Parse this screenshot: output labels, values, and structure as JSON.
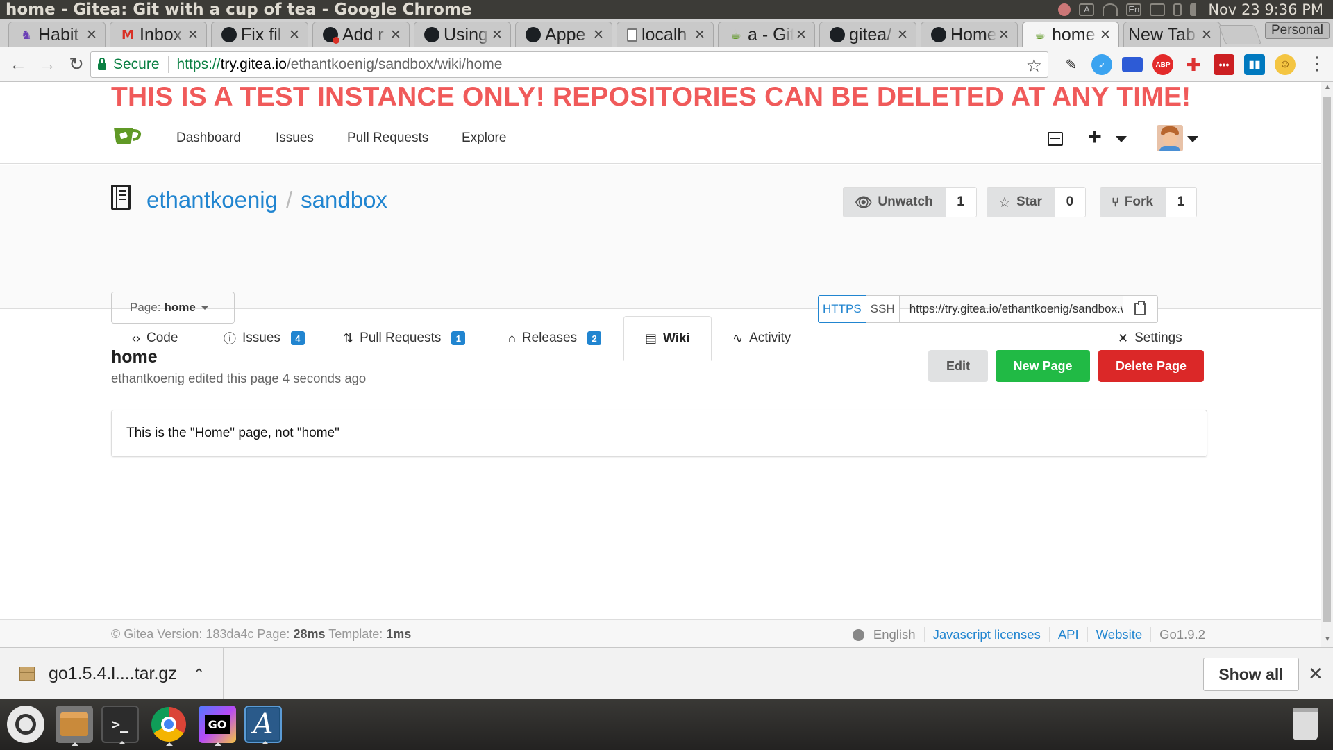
{
  "os": {
    "window_title": "home - Gitea: Git with a cup of tea - Google Chrome",
    "clock": "Nov 23  9:36 PM",
    "tray": [
      "paw-icon",
      "a-icon",
      "wifi-icon",
      "En",
      "mail-icon",
      "battery-icon",
      "volume-icon"
    ]
  },
  "browser": {
    "tabs": [
      {
        "title": "Habit",
        "icon": "habitica-icon"
      },
      {
        "title": "Inbox",
        "icon": "gmail-icon"
      },
      {
        "title": "Fix fil",
        "icon": "github-icon"
      },
      {
        "title": "Add r",
        "icon": "github-icon"
      },
      {
        "title": "Using",
        "icon": "github-icon"
      },
      {
        "title": "Appe",
        "icon": "github-icon"
      },
      {
        "title": "localh",
        "icon": "page-icon"
      },
      {
        "title": "a - Git",
        "icon": "gitea-icon"
      },
      {
        "title": "gitea/",
        "icon": "github-icon"
      },
      {
        "title": "Home",
        "icon": "github-icon"
      },
      {
        "title": "home",
        "icon": "gitea-icon",
        "active": true
      },
      {
        "title": "New Tab",
        "icon": ""
      }
    ],
    "profile": "Personal",
    "secure_label": "Secure",
    "url": {
      "scheme": "https://",
      "host": "try.gitea.io",
      "path": "/ethantkoenig/sandbox/wiki/home"
    },
    "extensions": [
      "pen-icon",
      "compass-icon",
      "calendar-icon",
      "adblock-icon",
      "plus-cross-icon",
      "lastpass-icon",
      "trello-icon",
      "emoji-icon"
    ]
  },
  "page": {
    "banner": "THIS IS A TEST INSTANCE ONLY! REPOSITORIES CAN BE DELETED AT ANY TIME!",
    "nav": {
      "dashboard": "Dashboard",
      "issues": "Issues",
      "pull_requests": "Pull Requests",
      "explore": "Explore"
    },
    "repo": {
      "owner": "ethantkoenig",
      "separator": "/",
      "name": "sandbox",
      "watch_label": "Unwatch",
      "watch_count": "1",
      "star_label": "Star",
      "star_count": "0",
      "fork_label": "Fork",
      "fork_count": "1"
    },
    "tabs": {
      "code": "Code",
      "issues": "Issues",
      "issues_count": "4",
      "pulls": "Pull Requests",
      "pulls_count": "1",
      "releases": "Releases",
      "releases_count": "2",
      "wiki": "Wiki",
      "activity": "Activity",
      "settings": "Settings"
    },
    "wiki": {
      "page_selector_prefix": "Page:",
      "page_selector_value": "home",
      "clone_https": "HTTPS",
      "clone_ssh": "SSH",
      "clone_url": "https://try.gitea.io/ethantkoenig/sandbox.wiki.git",
      "title": "home",
      "meta": "ethantkoenig edited this page 4 seconds ago",
      "edit_label": "Edit",
      "new_page_label": "New Page",
      "delete_page_label": "Delete Page",
      "content": "This is the \"Home\" page, not \"home\""
    },
    "footer": {
      "version_prefix": "© Gitea Version: 183da4c Page:",
      "page_time": "28ms",
      "template_prefix": "Template:",
      "template_time": "1ms",
      "language": "English",
      "js_licenses": "Javascript licenses",
      "api": "API",
      "website": "Website",
      "go_version": "Go1.9.2"
    }
  },
  "downloads": {
    "file": "go1.5.4.l....tar.gz",
    "show_all": "Show all"
  },
  "launcher": [
    "ubuntu-dash-icon",
    "files-icon",
    "terminal-icon",
    "chrome-icon",
    "goland-icon",
    "text-editor-icon",
    "trash-icon"
  ],
  "colors": {
    "banner": "#f05a5a",
    "link": "#2185d0",
    "new_page": "#21ba45",
    "delete_page": "#db2828",
    "gitea_green": "#609926"
  }
}
